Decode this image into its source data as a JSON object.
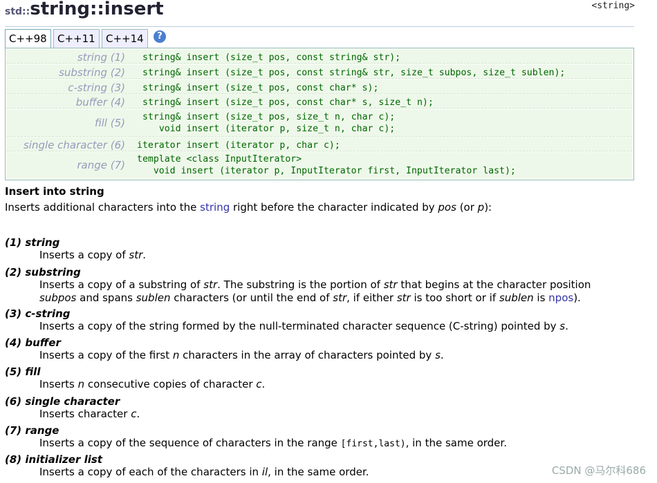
{
  "title": {
    "namespace": "std::",
    "name": "string::insert"
  },
  "header_tag": "<string>",
  "tabs": [
    "C++98",
    "C++11",
    "C++14"
  ],
  "help_icon": "question-circle-icon",
  "prototypes": [
    {
      "label": "string (1)",
      "code": "string& insert (size_t pos, const string& str);"
    },
    {
      "label": "substring (2)",
      "code": "string& insert (size_t pos, const string& str, size_t subpos, size_t sublen);"
    },
    {
      "label": "c-string (3)",
      "code": "string& insert (size_t pos, const char* s);"
    },
    {
      "label": "buffer (4)",
      "code": "string& insert (size_t pos, const char* s, size_t n);"
    },
    {
      "label": "fill (5)",
      "code": "string& insert (size_t pos, size_t n, char c);\n   void insert (iterator p, size_t n, char c);"
    },
    {
      "label": "single character (6)",
      "code": "iterator insert (iterator p, char c);"
    },
    {
      "label": "range (7)",
      "code": "template <class InputIterator>\n   void insert (iterator p, InputIterator first, InputIterator last);"
    }
  ],
  "section_title": "Insert into string",
  "intro": {
    "prefix": "Inserts additional characters into the ",
    "link": "string",
    "middle": " right before the character indicated by ",
    "pos": "pos",
    "or": " (or ",
    "p": "p",
    "suffix": "):"
  },
  "items": [
    {
      "heading": "(1) string"
    },
    {
      "heading": "(2) substring"
    },
    {
      "heading": "(3) c-string"
    },
    {
      "heading": "(4) buffer"
    },
    {
      "heading": "(5) fill"
    },
    {
      "heading": "(6) single character"
    },
    {
      "heading": "(7) range"
    },
    {
      "heading": "(8) initializer list"
    }
  ],
  "desc": {
    "d1": [
      "Inserts a copy of ",
      "str",
      "."
    ],
    "d2a": [
      "Inserts a copy of a substring of ",
      "str",
      ". The substring is the portion of ",
      "str",
      " that begins at the character position"
    ],
    "d2b": [
      "subpos",
      " and spans ",
      "sublen",
      " characters (or until the end of ",
      "str",
      ", if either ",
      "str",
      " is too short or if ",
      "sublen",
      " is ",
      "npos",
      ")."
    ],
    "d3": [
      "Inserts a copy of the string formed by the null-terminated character sequence (C-string) pointed by ",
      "s",
      "."
    ],
    "d4": [
      "Inserts a copy of the first ",
      "n",
      " characters in the array of characters pointed by ",
      "s",
      "."
    ],
    "d5": [
      "Inserts ",
      "n",
      " consecutive copies of character ",
      "c",
      "."
    ],
    "d6": [
      "Inserts character ",
      "c",
      "."
    ],
    "d7": [
      "Inserts a copy of the sequence of characters in the range ",
      "[first,last)",
      ", in the same order."
    ],
    "d8": [
      "Inserts a copy of each of the characters in ",
      "il",
      ", in the same order."
    ]
  },
  "watermark": "CSDN @马尔科686"
}
